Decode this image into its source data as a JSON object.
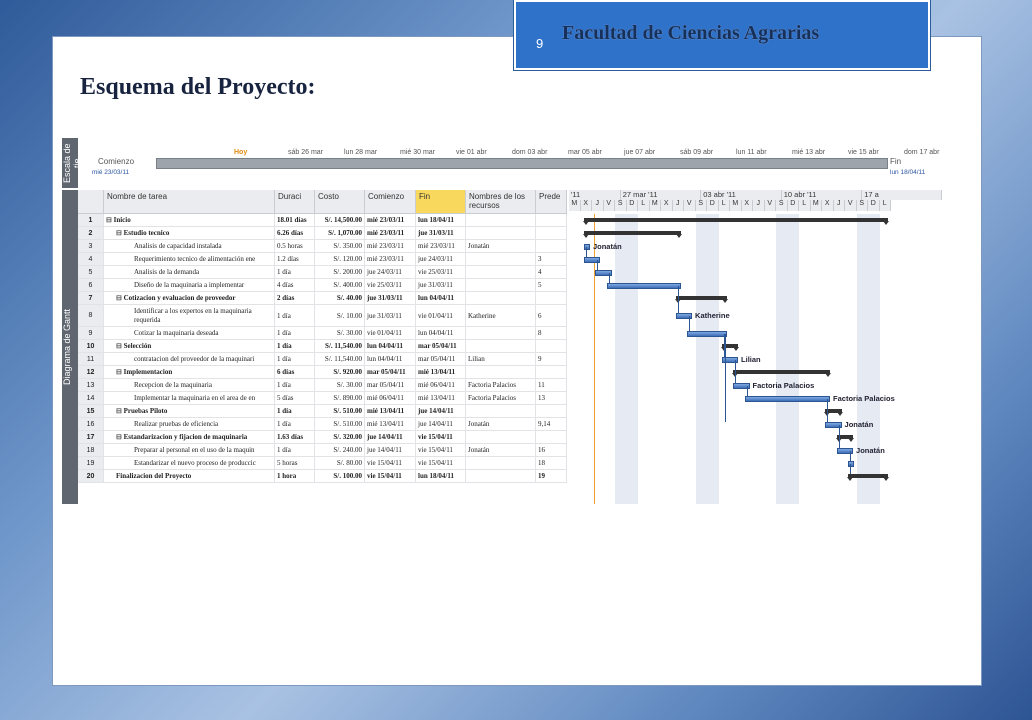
{
  "header": {
    "page_number": "9",
    "faculty": "Facultad de Ciencias Agrarias"
  },
  "slide_title": "Esquema del Proyecto:",
  "timeline": {
    "side_label": "Escala de tie",
    "today": "Hoy",
    "dates": [
      "sáb 26 mar",
      "lun 28 mar",
      "mié 30 mar",
      "vie 01 abr",
      "dom 03 abr",
      "mar 05 abr",
      "jue 07 abr",
      "sáb 09 abr",
      "lun 11 abr",
      "mié 13 abr",
      "vie 15 abr",
      "dom 17 abr"
    ],
    "start_label": "Comienzo",
    "start_date": "mié 23/03/11",
    "end_label": "Fin",
    "end_date": "lun 18/04/11"
  },
  "gantt_side_label": "Diagrama de Gantt",
  "columns": {
    "nombre": "Nombre de tarea",
    "duracion": "Duraci",
    "costo": "Costo",
    "comienzo": "Comienzo",
    "fin": "Fin",
    "recursos": "Nombres de los recursos",
    "pred": "Prede"
  },
  "tasks": [
    {
      "id": "1",
      "name": "Inicio",
      "dur": "18.01 días",
      "cost": "S/. 14,500.00",
      "start": "mié 23/03/11",
      "end": "lun 18/04/11",
      "res": "",
      "pred": "",
      "summary": true,
      "level": 0
    },
    {
      "id": "2",
      "name": "Estudio tecnico",
      "dur": "6.26 días",
      "cost": "S/. 1,070.00",
      "start": "mié 23/03/11",
      "end": "jue 31/03/11",
      "res": "",
      "pred": "",
      "summary": true,
      "level": 1
    },
    {
      "id": "3",
      "name": "Analisis de capacidad instalada",
      "dur": "0.5 horas",
      "cost": "S/. 350.00",
      "start": "mié 23/03/11",
      "end": "mié 23/03/11",
      "res": "Jonatán",
      "pred": "",
      "summary": false,
      "level": 2
    },
    {
      "id": "4",
      "name": "Requerimiento tecnico de alimentación ene",
      "dur": "1.2 días",
      "cost": "S/. 120.00",
      "start": "mié 23/03/11",
      "end": "jue 24/03/11",
      "res": "",
      "pred": "3",
      "summary": false,
      "level": 2
    },
    {
      "id": "5",
      "name": "Analisis de la demanda",
      "dur": "1 día",
      "cost": "S/. 200.00",
      "start": "jue 24/03/11",
      "end": "vie 25/03/11",
      "res": "",
      "pred": "4",
      "summary": false,
      "level": 2
    },
    {
      "id": "6",
      "name": "Diseño de la maquinaria a implementar",
      "dur": "4 días",
      "cost": "S/. 400.00",
      "start": "vie 25/03/11",
      "end": "jue 31/03/11",
      "res": "",
      "pred": "5",
      "summary": false,
      "level": 2
    },
    {
      "id": "7",
      "name": "Cotizacion y evaluacion de proveedor",
      "dur": "2 días",
      "cost": "S/. 40.00",
      "start": "jue 31/03/11",
      "end": "lun 04/04/11",
      "res": "",
      "pred": "",
      "summary": true,
      "level": 1
    },
    {
      "id": "8",
      "name": "Identificar a los expertos en la maquinaria requerida",
      "dur": "1 día",
      "cost": "S/. 10.00",
      "start": "jue 31/03/11",
      "end": "vie 01/04/11",
      "res": "Katherine",
      "pred": "6",
      "summary": false,
      "level": 2,
      "tall": true
    },
    {
      "id": "9",
      "name": "Cotizar la maquinaria deseada",
      "dur": "1 día",
      "cost": "S/. 30.00",
      "start": "vie 01/04/11",
      "end": "lun 04/04/11",
      "res": "",
      "pred": "8",
      "summary": false,
      "level": 2
    },
    {
      "id": "10",
      "name": "Selección",
      "dur": "1 día",
      "cost": "S/. 11,540.00",
      "start": "lun 04/04/11",
      "end": "mar 05/04/11",
      "res": "",
      "pred": "",
      "summary": true,
      "level": 1
    },
    {
      "id": "11",
      "name": "contratacion del proveedor de la maquinari",
      "dur": "1 día",
      "cost": "S/. 11,540.00",
      "start": "lun 04/04/11",
      "end": "mar 05/04/11",
      "res": "Lilian",
      "pred": "9",
      "summary": false,
      "level": 2
    },
    {
      "id": "12",
      "name": "Implementacion",
      "dur": "6 días",
      "cost": "S/. 920.00",
      "start": "mar 05/04/11",
      "end": "mié 13/04/11",
      "res": "",
      "pred": "",
      "summary": true,
      "level": 1
    },
    {
      "id": "13",
      "name": "Recepcion de la maquinaria",
      "dur": "1 día",
      "cost": "S/. 30.00",
      "start": "mar 05/04/11",
      "end": "mié 06/04/11",
      "res": "Factoria Palacios",
      "pred": "11",
      "summary": false,
      "level": 2
    },
    {
      "id": "14",
      "name": "Implementar la maquinaria en el area de en",
      "dur": "5 días",
      "cost": "S/. 890.00",
      "start": "mié 06/04/11",
      "end": "mié 13/04/11",
      "res": "Factoria Palacios",
      "pred": "13",
      "summary": false,
      "level": 2
    },
    {
      "id": "15",
      "name": "Pruebas Piloto",
      "dur": "1 día",
      "cost": "S/. 510.00",
      "start": "mié 13/04/11",
      "end": "jue 14/04/11",
      "res": "",
      "pred": "",
      "summary": true,
      "level": 1
    },
    {
      "id": "16",
      "name": "Realizar pruebas de eficiencia",
      "dur": "1 día",
      "cost": "S/. 510.00",
      "start": "mié 13/04/11",
      "end": "jue 14/04/11",
      "res": "Jonatán",
      "pred": "9,14",
      "summary": false,
      "level": 2
    },
    {
      "id": "17",
      "name": "Estandarizacion y fijacion de maquinaria",
      "dur": "1.63 días",
      "cost": "S/. 320.00",
      "start": "jue 14/04/11",
      "end": "vie 15/04/11",
      "res": "",
      "pred": "",
      "summary": true,
      "level": 1
    },
    {
      "id": "18",
      "name": "Preparar al personal en el uso de la maquin",
      "dur": "1 día",
      "cost": "S/. 240.00",
      "start": "jue 14/04/11",
      "end": "vie 15/04/11",
      "res": "Jonatán",
      "pred": "16",
      "summary": false,
      "level": 2
    },
    {
      "id": "19",
      "name": "Estandarizar el nuevo proceso de produccic",
      "dur": "5 horas",
      "cost": "S/. 80.00",
      "start": "vie 15/04/11",
      "end": "vie 15/04/11",
      "res": "",
      "pred": "18",
      "summary": false,
      "level": 2
    },
    {
      "id": "20",
      "name": "Finalizacion del Proyecto",
      "dur": "1 hora",
      "cost": "S/. 100.00",
      "start": "vie 15/04/11",
      "end": "lun 18/04/11",
      "res": "",
      "pred": "19",
      "summary": true,
      "level": 1
    }
  ],
  "gantt": {
    "weeks": [
      "'11",
      "27 mar '11",
      "03 abr '11",
      "10 abr '11",
      "17 a"
    ],
    "days": [
      "M",
      "X",
      "J",
      "V",
      "S",
      "D",
      "L",
      "M",
      "X",
      "J",
      "V",
      "S",
      "D",
      "L",
      "M",
      "X",
      "J",
      "V",
      "S",
      "D",
      "L",
      "M",
      "X",
      "J",
      "V",
      "S",
      "D",
      "L"
    ],
    "labels": {
      "3": "Jonatán",
      "8": "Katherine",
      "11": "Lilian",
      "13": "Factoria Palacios",
      "14": "Factoria Palacios",
      "16": "Jonatán",
      "18": "Jonatán"
    }
  }
}
